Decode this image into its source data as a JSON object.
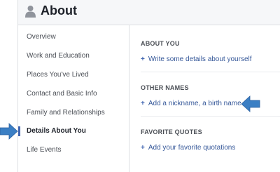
{
  "header": {
    "title": "About",
    "icon": "person-icon"
  },
  "sidebar": {
    "items": [
      {
        "label": "Overview",
        "active": false
      },
      {
        "label": "Work and Education",
        "active": false
      },
      {
        "label": "Places You've Lived",
        "active": false
      },
      {
        "label": "Contact and Basic Info",
        "active": false
      },
      {
        "label": "Family and Relationships",
        "active": false
      },
      {
        "label": "Details About You",
        "active": true
      },
      {
        "label": "Life Events",
        "active": false
      }
    ]
  },
  "main": {
    "sections": [
      {
        "title": "ABOUT YOU",
        "link": "Write some details about yourself"
      },
      {
        "title": "OTHER NAMES",
        "link": "Add a nickname, a birth name..."
      },
      {
        "title": "FAVORITE QUOTES",
        "link": "Add your favorite quotations"
      }
    ]
  },
  "colors": {
    "link": "#365899",
    "arrow": "#3b7fc4",
    "header_bg": "#f6f7f9",
    "border": "#dddfe2"
  },
  "annotations": [
    {
      "icon": "arrow-right-icon",
      "points_to": "Details About You"
    },
    {
      "icon": "arrow-left-icon",
      "points_to": "Add a nickname, a birth name..."
    }
  ]
}
